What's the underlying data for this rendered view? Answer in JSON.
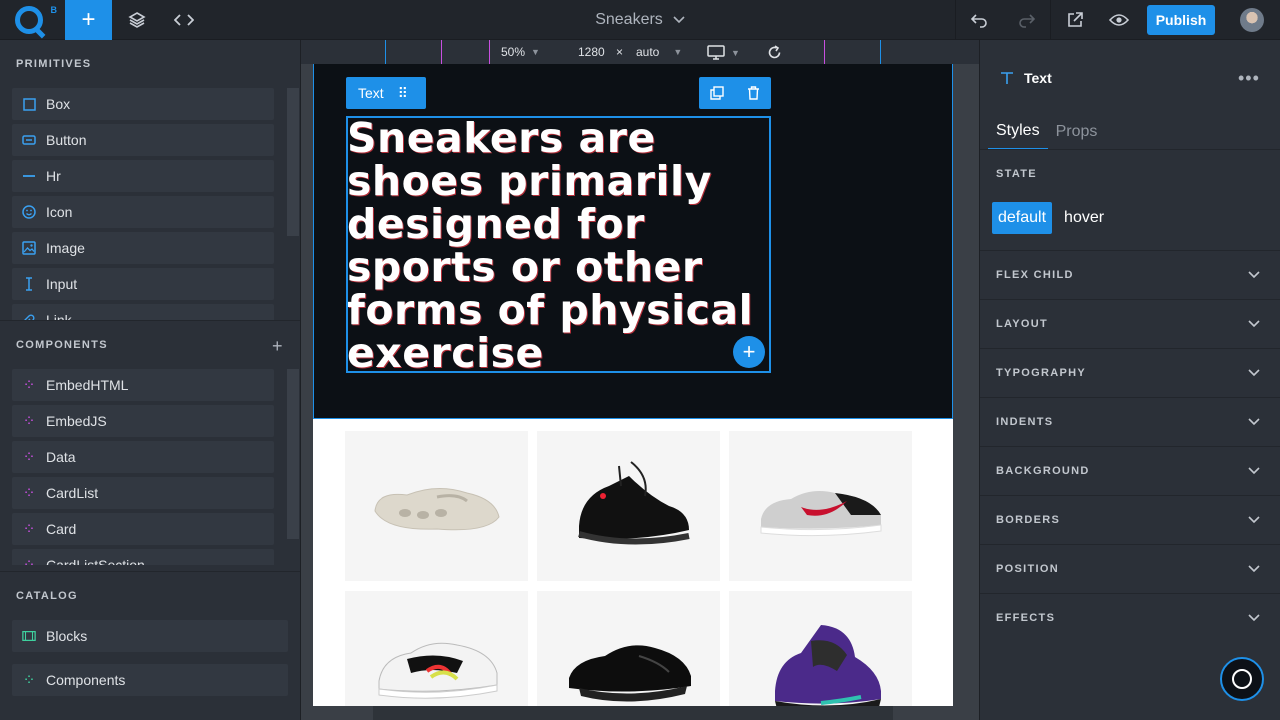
{
  "topbar": {
    "logo_beta": "B",
    "add_icon": "+",
    "page_title": "Sneakers",
    "publish_label": "Publish"
  },
  "left": {
    "primitives_title": "PRIMITIVES",
    "primitives": [
      {
        "label": "Box",
        "icon": "square-icon"
      },
      {
        "label": "Button",
        "icon": "button-icon"
      },
      {
        "label": "Hr",
        "icon": "hr-icon"
      },
      {
        "label": "Icon",
        "icon": "smiley-icon"
      },
      {
        "label": "Image",
        "icon": "image-icon"
      },
      {
        "label": "Input",
        "icon": "text-cursor-icon"
      },
      {
        "label": "Link",
        "icon": "link-icon"
      }
    ],
    "components_title": "COMPONENTS",
    "components": [
      {
        "label": "EmbedHTML"
      },
      {
        "label": "EmbedJS"
      },
      {
        "label": "Data"
      },
      {
        "label": "CardList"
      },
      {
        "label": "Card"
      },
      {
        "label": "CardListSection"
      }
    ],
    "catalog_title": "CATALOG",
    "catalog": [
      {
        "label": "Blocks"
      },
      {
        "label": "Components"
      }
    ]
  },
  "canvas": {
    "zoom": "50%",
    "width": "1280",
    "times": "×",
    "height": "auto",
    "selected_label": "Text",
    "headline": "Sneakers are shoes primarily designed for sports or other forms of physical exercise"
  },
  "right": {
    "element_name": "Text",
    "tabs": [
      "Styles",
      "Props"
    ],
    "state_title": "STATE",
    "states": [
      "default",
      "hover"
    ],
    "sections": [
      "FLEX CHILD",
      "LAYOUT",
      "TYPOGRAPHY",
      "INDENTS",
      "BACKGROUND",
      "BORDERS",
      "POSITION",
      "EFFECTS"
    ]
  },
  "colors": {
    "accent": "#1e90e8",
    "panel": "#2b3038",
    "hero_bg": "#0c1015"
  }
}
